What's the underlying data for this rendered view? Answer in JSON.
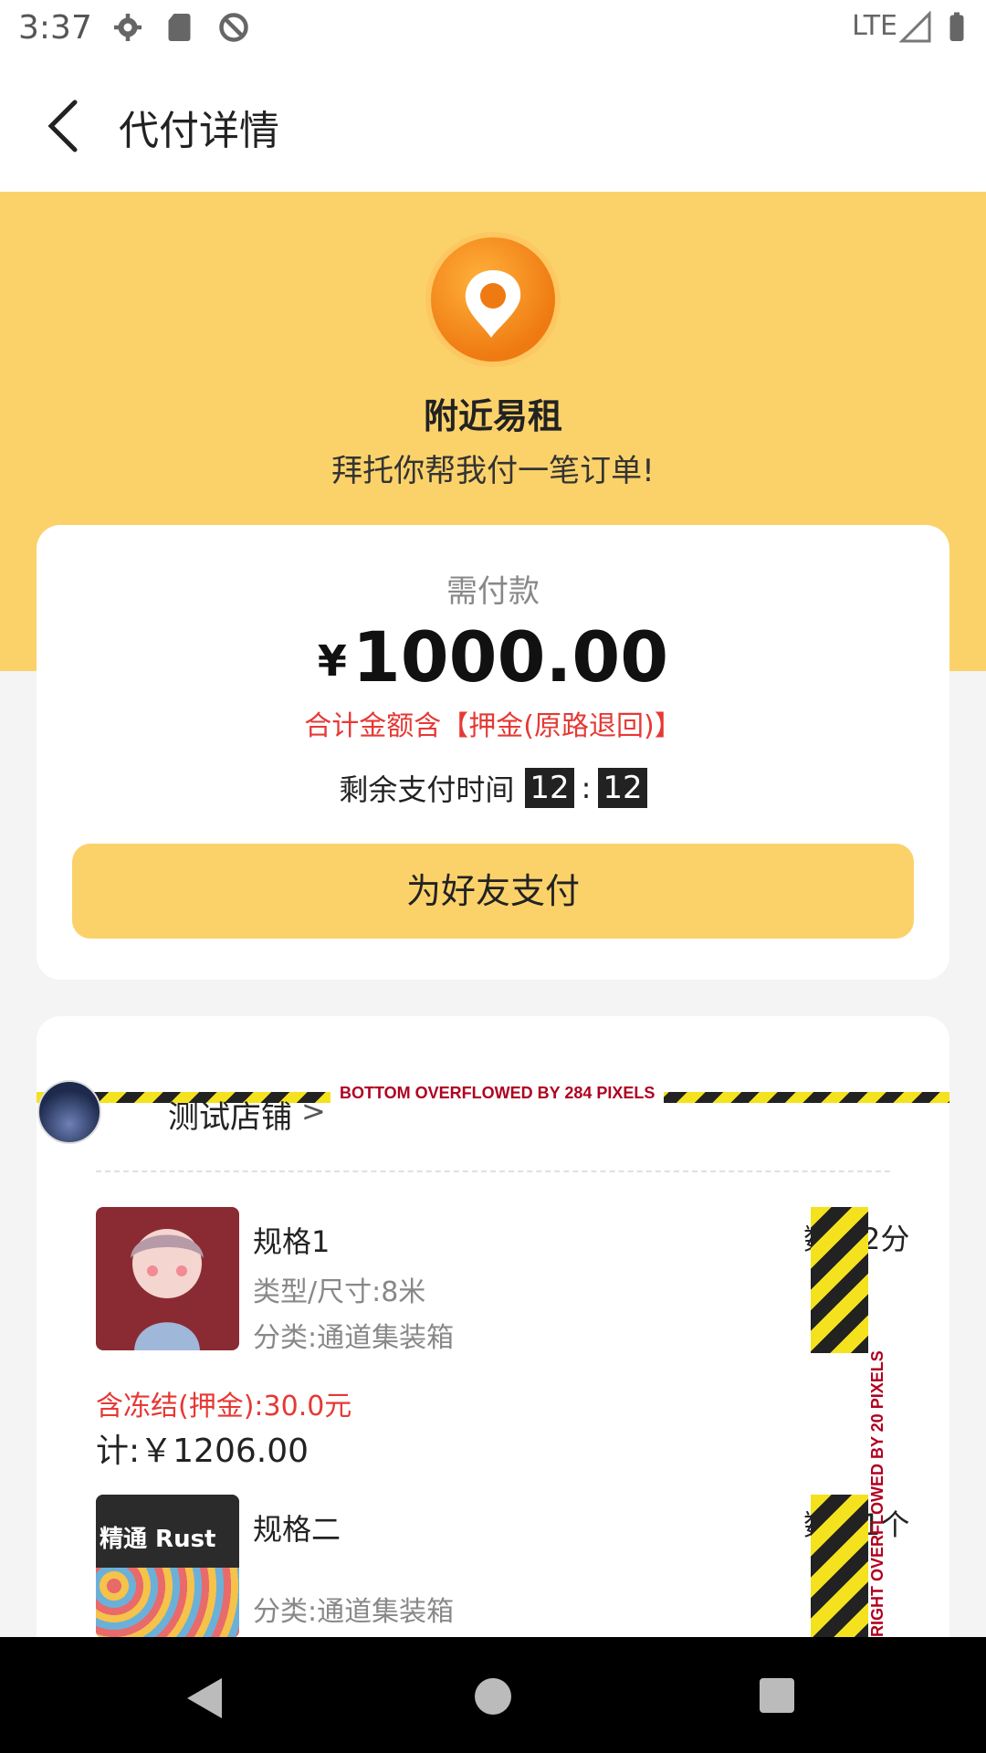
{
  "status_bar": {
    "time": "3:37",
    "network": "LTE"
  },
  "app_bar": {
    "title": "代付详情"
  },
  "hero": {
    "app_name": "附近易租",
    "subtitle": "拜托你帮我付一笔订单!"
  },
  "payment": {
    "need_label": "需付款",
    "currency": "¥",
    "amount": "1000.00",
    "deposit_note": "合计金额含【押金(原路退回)】",
    "countdown_label": "剩余支付时间",
    "countdown_min": "12",
    "countdown_colon": ":",
    "countdown_sec": "12",
    "button_label": "为好友支付"
  },
  "order": {
    "overflow_bottom_label": "BOTTOM OVERFLOWED BY 284 PIXELS",
    "overflow_right_label": "RIGHT OVERFLOWED BY 20 PIXELS",
    "shop_name": "测试店铺",
    "shop_arrow": ">",
    "items": [
      {
        "title": "规格1",
        "type": "类型/尺寸:8米",
        "category": "分类:通道集装箱",
        "qty": "数量2分",
        "deposit": "含冻结(押金):30.0元",
        "subtotal": "计:￥1206.00"
      },
      {
        "title": "规格二",
        "category": "分类:通道集装箱",
        "qty": "数量1个",
        "image_text": "精通 Rust"
      }
    ]
  },
  "colors": {
    "accent_yellow": "#fbd26a",
    "price_red": "#e53935"
  }
}
